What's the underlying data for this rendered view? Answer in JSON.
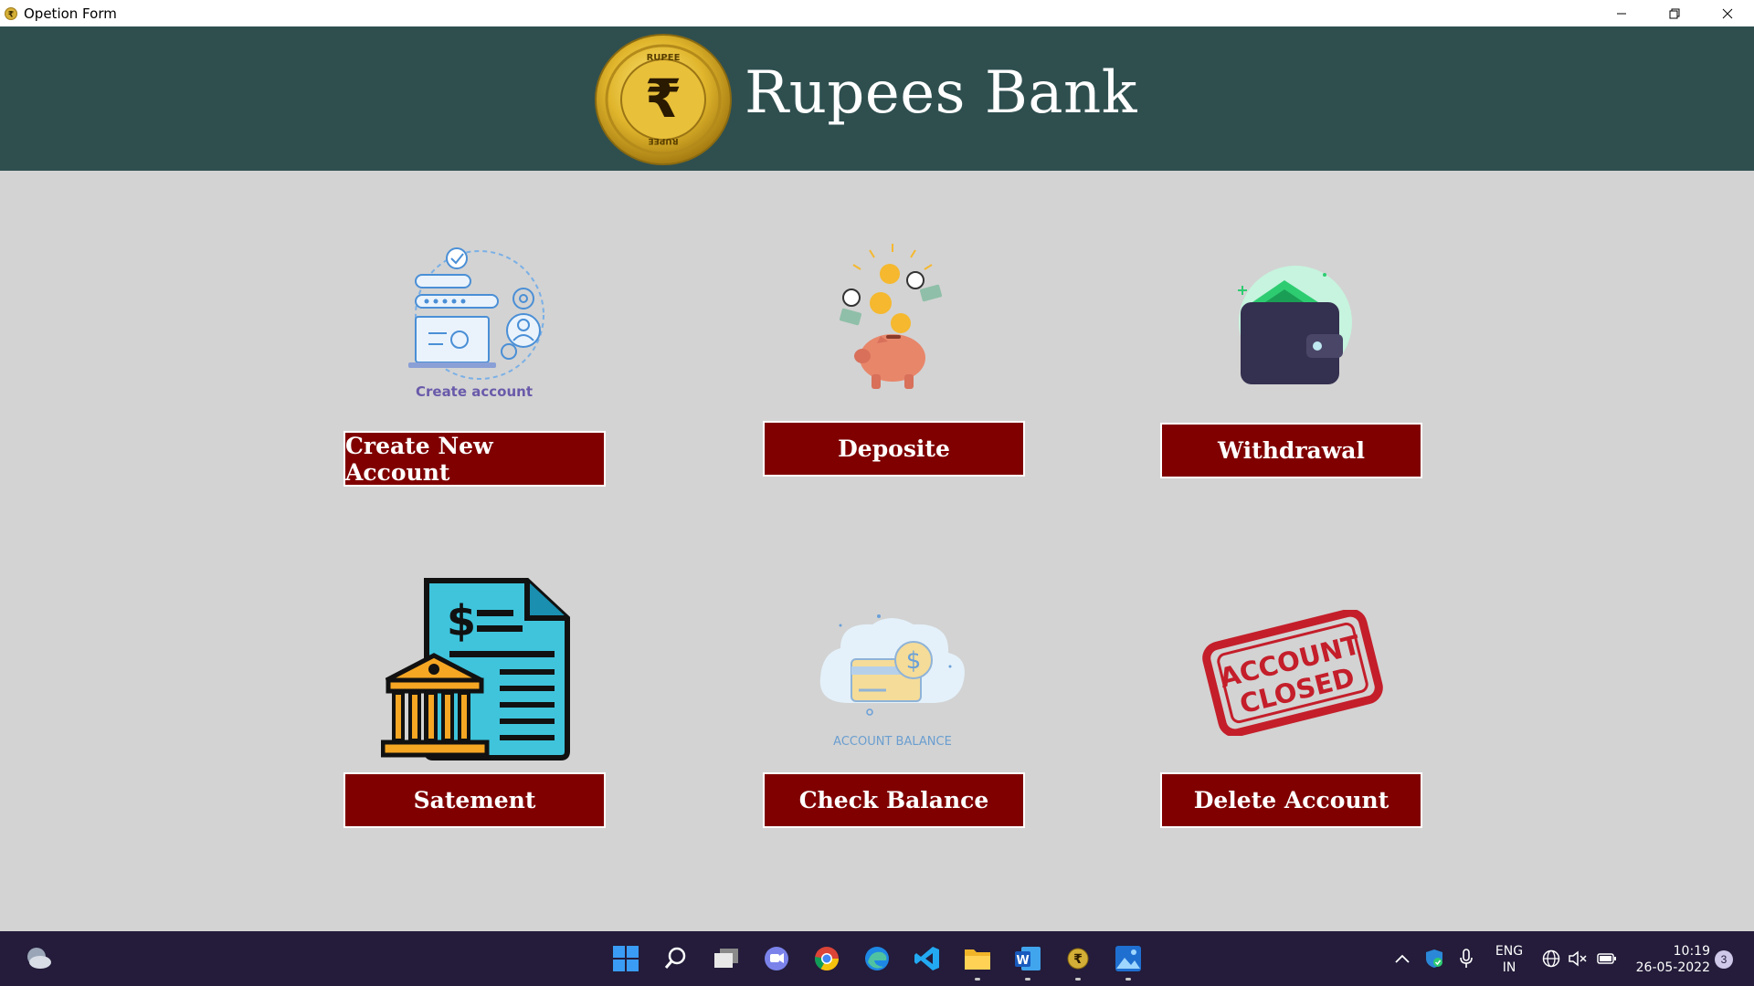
{
  "window": {
    "title": "Opetion Form",
    "controls": {
      "minimize": "minimize",
      "restore": "restore",
      "close": "close"
    }
  },
  "header": {
    "bank_name": "Rupees Bank",
    "logo": {
      "top_text": "RUPEE",
      "bottom_text": "RUPEE",
      "symbol": "₹"
    },
    "colors": {
      "banner": "#2f4f4f",
      "coin": "#d4af37"
    }
  },
  "menu": {
    "create_account": {
      "label": "Create New Account",
      "illustration_caption": "Create account",
      "icon": "create-account-illustration"
    },
    "deposit": {
      "label": "Deposite",
      "icon": "piggy-bank-coins-illustration"
    },
    "withdrawal": {
      "label": "Withdrawal",
      "icon": "wallet-illustration"
    },
    "statement": {
      "label": "Satement",
      "icon": "bank-statement-illustration"
    },
    "check_balance": {
      "label": "Check Balance",
      "illustration_caption": "ACCOUNT BALANCE",
      "icon": "account-balance-illustration"
    },
    "delete_account": {
      "label": "Delete Account",
      "stamp_line1": "ACCOUNT",
      "stamp_line2": "CLOSED",
      "icon": "account-closed-stamp"
    },
    "colors": {
      "button": "#800000",
      "page_bg": "#d3d3d3"
    }
  },
  "taskbar": {
    "apps": [
      "start-icon",
      "search-icon",
      "task-view-icon",
      "chat-icon",
      "chrome-icon",
      "edge-icon",
      "vscode-icon",
      "file-explorer-icon",
      "word-icon",
      "rupee-app-icon",
      "photos-icon"
    ],
    "tray": {
      "lang_line1": "ENG",
      "lang_line2": "IN",
      "time": "10:19",
      "date": "26-05-2022",
      "notifications": "3"
    },
    "colors": {
      "bar": "#241c3a"
    }
  }
}
